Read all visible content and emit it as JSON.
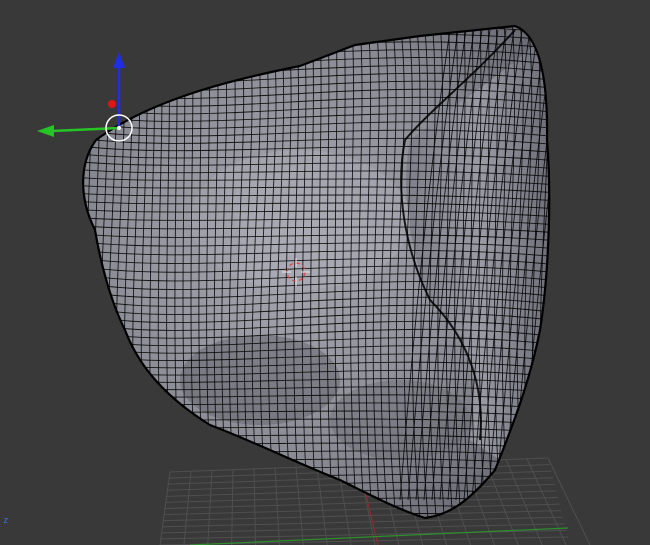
{
  "viewport": {
    "background": "#393939",
    "corner_axis_label": "z"
  },
  "object": {
    "type": "mesh",
    "shading": "solid-with-wireframe",
    "colors": {
      "face_light": "#a4a4ae",
      "face_dark": "#6b6b75",
      "wire": "#000000"
    }
  },
  "manipulator": {
    "axes": [
      {
        "name": "z",
        "color": "#1f2ee6"
      },
      {
        "name": "y",
        "color": "#26c526"
      },
      {
        "name": "x",
        "color": "#e01515"
      }
    ]
  },
  "grid": {
    "line_color": "#4f4f4f",
    "x_axis_color": "#8e2b2b",
    "y_axis_color": "#2f8e2f"
  },
  "cursor_3d": {
    "colors": [
      "#e04040",
      "#ffffff"
    ]
  }
}
